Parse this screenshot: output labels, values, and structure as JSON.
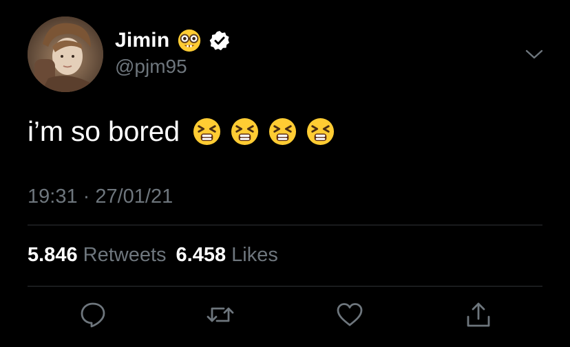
{
  "author": {
    "name": "Jimin",
    "handle": "@pjm95",
    "name_emoji": "nerd-face-emoji",
    "verified_icon": "verified-badge-icon"
  },
  "tweet": {
    "text": "i’m so bored",
    "emojis": [
      "tired-face-emoji",
      "tired-face-emoji",
      "tired-face-emoji",
      "tired-face-emoji"
    ],
    "timestamp": "19:31 · 27/01/21"
  },
  "stats": {
    "retweets_count": "5.846",
    "retweets_label": "Retweets",
    "likes_count": "6.458",
    "likes_label": "Likes"
  },
  "actions": [
    {
      "name": "reply",
      "icon": "reply-icon"
    },
    {
      "name": "retweet",
      "icon": "retweet-icon"
    },
    {
      "name": "like",
      "icon": "heart-icon"
    },
    {
      "name": "share",
      "icon": "share-icon"
    }
  ],
  "colors": {
    "background": "#000000",
    "text": "#ffffff",
    "secondary": "#6e767d",
    "divider": "#2f3336",
    "emoji_yellow": "#ffcc33"
  }
}
